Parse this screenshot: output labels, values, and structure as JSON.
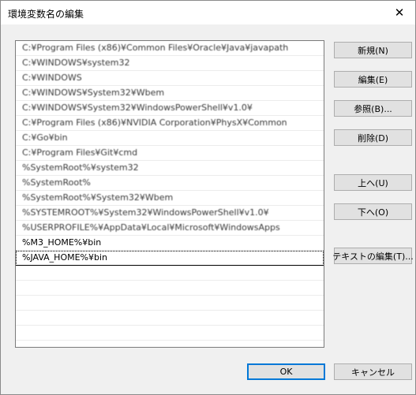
{
  "window": {
    "title": "環境変数名の編集",
    "close_label": "✕"
  },
  "path_list": {
    "rows": [
      {
        "text": "C:¥Program Files (x86)¥Common Files¥Oracle¥Java¥javapath",
        "blurred": true
      },
      {
        "text": "C:¥WINDOWS¥system32",
        "blurred": true
      },
      {
        "text": "C:¥WINDOWS",
        "blurred": true
      },
      {
        "text": "C:¥WINDOWS¥System32¥Wbem",
        "blurred": true
      },
      {
        "text": "C:¥WINDOWS¥System32¥WindowsPowerShell¥v1.0¥",
        "blurred": true
      },
      {
        "text": "C:¥Program Files (x86)¥NVIDIA Corporation¥PhysX¥Common",
        "blurred": true
      },
      {
        "text": "C:¥Go¥bin",
        "blurred": true
      },
      {
        "text": "C:¥Program Files¥Git¥cmd",
        "blurred": true
      },
      {
        "text": "%SystemRoot%¥system32",
        "blurred": true
      },
      {
        "text": "%SystemRoot%",
        "blurred": true
      },
      {
        "text": "%SystemRoot%¥System32¥Wbem",
        "blurred": true
      },
      {
        "text": "%SYSTEMROOT%¥System32¥WindowsPowerShell¥v1.0¥",
        "blurred": true
      },
      {
        "text": "%USERPROFILE%¥AppData¥Local¥Microsoft¥WindowsApps",
        "blurred": true
      },
      {
        "text": "%M3_HOME%¥bin",
        "blurred": false
      },
      {
        "text": "%JAVA_HOME%¥bin",
        "blurred": false,
        "selected": true
      },
      {
        "text": ""
      },
      {
        "text": ""
      },
      {
        "text": ""
      },
      {
        "text": ""
      },
      {
        "text": ""
      },
      {
        "text": ""
      }
    ]
  },
  "buttons": {
    "new": "新規(N)",
    "edit": "編集(E)",
    "browse": "参照(B)...",
    "delete": "削除(D)",
    "up": "上へ(U)",
    "down": "下へ(O)",
    "edit_text": "テキストの編集(T)...",
    "ok": "OK",
    "cancel": "キャンセル"
  }
}
